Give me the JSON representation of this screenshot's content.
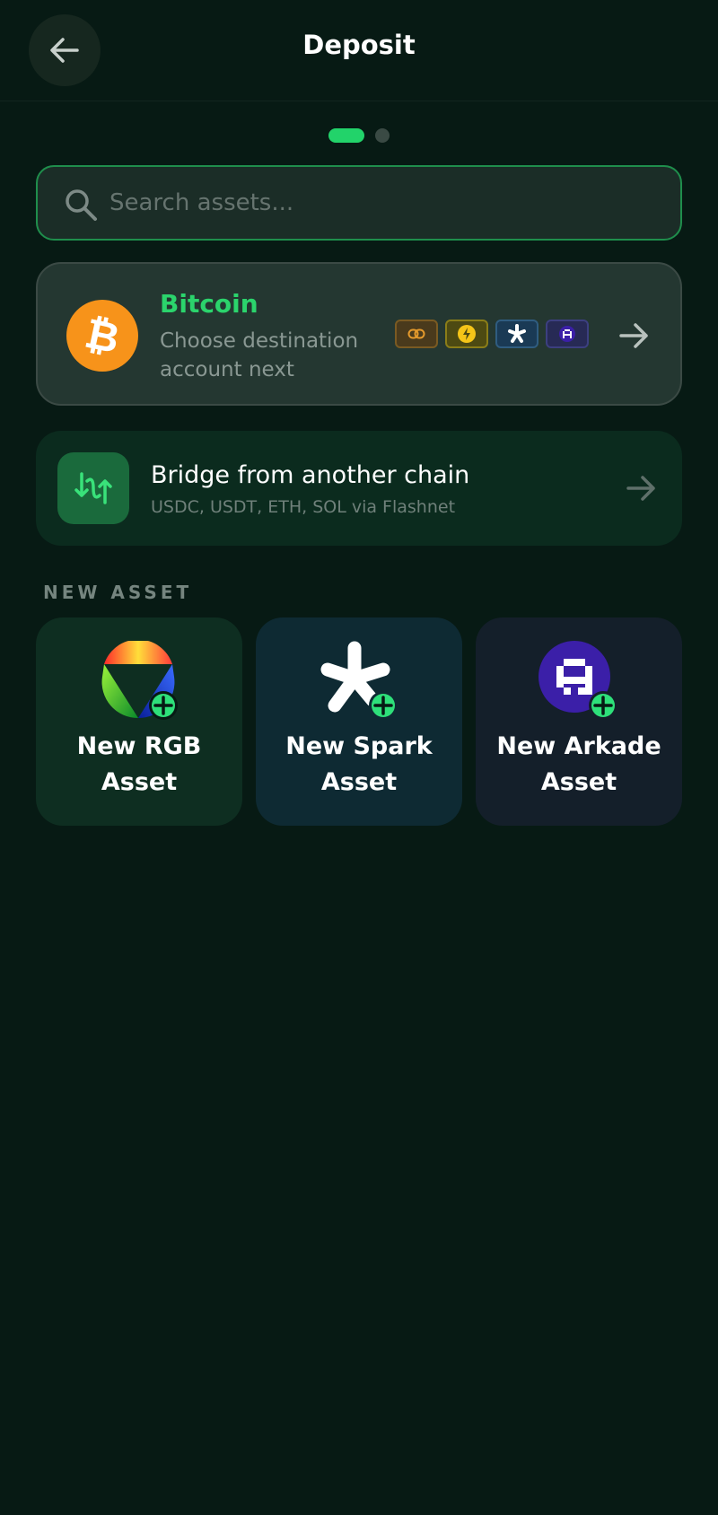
{
  "header": {
    "title": "Deposit",
    "back_icon": "arrow-left-icon"
  },
  "pagination": {
    "current": 1,
    "total": 2
  },
  "search": {
    "placeholder": "Search assets...",
    "value": "",
    "icon": "search-icon"
  },
  "bitcoin_card": {
    "name": "Bitcoin",
    "subtitle": "Choose destination account next",
    "icon": "bitcoin-icon",
    "network_chips": [
      "onchain-link-icon",
      "lightning-icon",
      "spark-icon",
      "arkade-icon"
    ],
    "arrow_icon": "arrow-right-icon"
  },
  "bridge_card": {
    "title": "Bridge from another chain",
    "subtitle": "USDC, USDT, ETH, SOL via Flashnet",
    "icon": "bridge-swap-icon",
    "arrow_icon": "arrow-right-icon"
  },
  "new_asset": {
    "section_label": "NEW ASSET",
    "tiles": [
      {
        "label": "New RGB Asset",
        "icon": "rgb-logo-icon"
      },
      {
        "label": "New Spark Asset",
        "icon": "spark-asterisk-icon"
      },
      {
        "label": "New Arkade Asset",
        "icon": "arkade-logo-icon"
      }
    ]
  },
  "colors": {
    "background": "#071a14",
    "accent_green": "#22d36a",
    "bitcoin_orange": "#f7931a"
  }
}
